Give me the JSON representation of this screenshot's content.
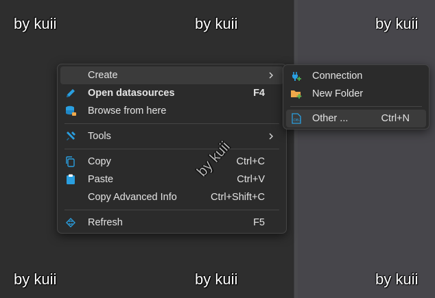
{
  "watermark": {
    "text": "by kuii"
  },
  "context_menu": {
    "items": [
      {
        "label": "Create",
        "shortcut": "",
        "icon": "none"
      },
      {
        "label": "Open datasources",
        "shortcut": "F4",
        "icon": "pencil-icon"
      },
      {
        "label": "Browse from here",
        "shortcut": "",
        "icon": "database-icon"
      },
      {
        "label": "Tools",
        "shortcut": "",
        "icon": "tools-icon"
      },
      {
        "label": "Copy",
        "shortcut": "Ctrl+C",
        "icon": "copy-icon"
      },
      {
        "label": "Paste",
        "shortcut": "Ctrl+V",
        "icon": "clipboard-icon"
      },
      {
        "label": "Copy Advanced Info",
        "shortcut": "Ctrl+Shift+C",
        "icon": "none"
      },
      {
        "label": "Refresh",
        "shortcut": "F5",
        "icon": "refresh-icon"
      }
    ]
  },
  "submenu": {
    "items": [
      {
        "label": "Connection",
        "shortcut": "",
        "icon": "plug-add-icon"
      },
      {
        "label": "New Folder",
        "shortcut": "",
        "icon": "folder-add-icon"
      },
      {
        "label": "Other ...",
        "shortcut": "Ctrl+N",
        "icon": "object-icon"
      }
    ]
  },
  "colors": {
    "accent": "#2a9fe0",
    "menu_background": "#2b2b2b",
    "menu_hover": "#3b3b3b",
    "text": "#e4e4e4",
    "folder": "#f0a84a",
    "plus": "#4caf50"
  }
}
